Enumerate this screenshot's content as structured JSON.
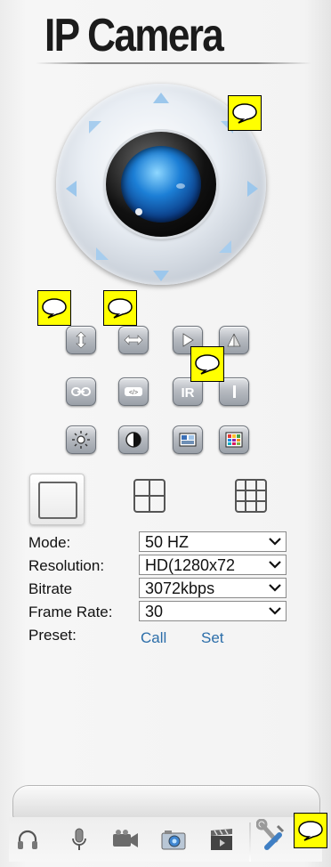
{
  "header": {
    "title": "IP Camera"
  },
  "form": {
    "mode": {
      "label": "Mode:",
      "value": "50 HZ"
    },
    "resolution": {
      "label": "Resolution:",
      "value": "HD(1280x72"
    },
    "bitrate": {
      "label": "Bitrate",
      "value": "3072kbps"
    },
    "frame_rate": {
      "label": "Frame Rate:",
      "value": "30"
    },
    "preset": {
      "label": "Preset:",
      "call": "Call",
      "set": "Set"
    }
  },
  "colors": {
    "accent_link": "#2c6ea9",
    "annotation": "#ffff00"
  },
  "icons": [
    "flip-vertical-icon",
    "mirror-horizontal-icon",
    "play-icon",
    "mirror-triangle-icon",
    "link-icon",
    "code-icon",
    "ir-icon",
    "ir-off-icon",
    "brightness-icon",
    "contrast-icon",
    "hue-icon",
    "saturation-icon",
    "headphones-icon",
    "microphone-icon",
    "video-record-icon",
    "snapshot-icon",
    "clapperboard-icon",
    "settings-wrench-icon"
  ]
}
